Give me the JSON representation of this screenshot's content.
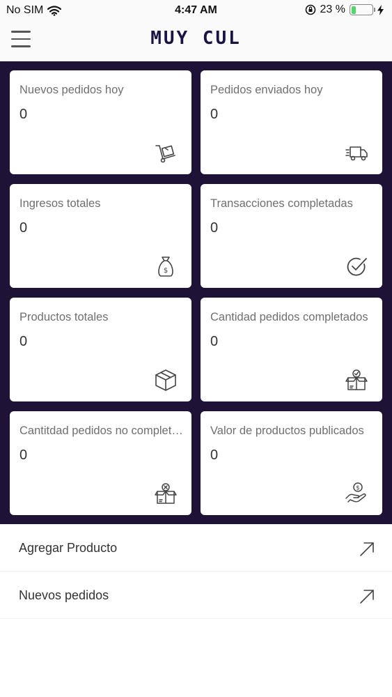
{
  "status_bar": {
    "carrier": "No SIM",
    "time": "4:47 AM",
    "battery_percent": "23 %",
    "battery_level": 0.23
  },
  "header": {
    "brand": "MUY CUL",
    "menu_icon": "hamburger-icon"
  },
  "cards": [
    {
      "title": "Nuevos pedidos hoy",
      "value": "0",
      "icon": "dolly-icon"
    },
    {
      "title": "Pedidos enviados hoy",
      "value": "0",
      "icon": "truck-icon"
    },
    {
      "title": "Ingresos totales",
      "value": "0",
      "icon": "money-bag-icon"
    },
    {
      "title": "Transacciones completadas",
      "value": "0",
      "icon": "check-circle-icon"
    },
    {
      "title": "Productos totales",
      "value": "0",
      "icon": "box-icon"
    },
    {
      "title": "Cantidad pedidos completados",
      "value": "0",
      "icon": "box-check-icon"
    },
    {
      "title": "Cantitdad pedidos no completados",
      "value": "0",
      "icon": "box-x-icon"
    },
    {
      "title": "Valor de productos publicados",
      "value": "0",
      "icon": "hand-coin-icon"
    }
  ],
  "actions": [
    {
      "label": "Agregar Producto",
      "icon": "arrow-up-right-icon"
    },
    {
      "label": "Nuevos pedidos",
      "icon": "arrow-up-right-icon"
    }
  ],
  "colors": {
    "grid_background": "#1e1237",
    "brand": "#1a1446",
    "battery": "#4cd964"
  }
}
